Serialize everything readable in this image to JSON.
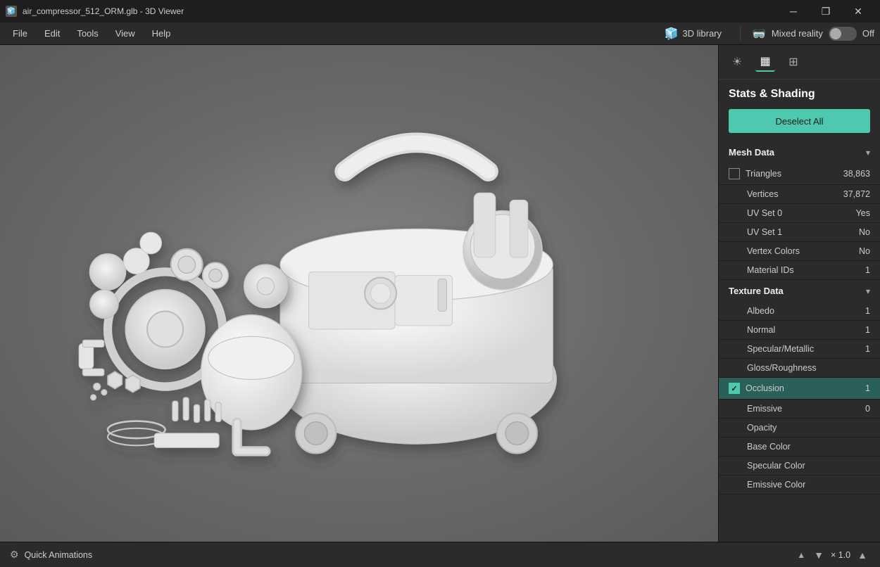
{
  "titleBar": {
    "title": "air_compressor_512_ORM.glb - 3D Viewer",
    "minBtn": "─",
    "maxBtn": "❐",
    "closeBtn": "✕"
  },
  "menuBar": {
    "items": [
      "File",
      "Edit",
      "Tools",
      "View",
      "Help"
    ],
    "library": "3D library",
    "mixedReality": "Mixed reality",
    "toggleState": "Off"
  },
  "panel": {
    "sectionTitle": "Stats & Shading",
    "deselectBtn": "Deselect All",
    "meshData": {
      "label": "Mesh Data",
      "rows": [
        {
          "label": "Triangles",
          "value": "38,863",
          "hasCheckbox": true,
          "checked": false
        },
        {
          "label": "Vertices",
          "value": "37,872"
        },
        {
          "label": "UV Set 0",
          "value": "Yes"
        },
        {
          "label": "UV Set 1",
          "value": "No"
        },
        {
          "label": "Vertex Colors",
          "value": "No"
        },
        {
          "label": "Material IDs",
          "value": "1"
        }
      ]
    },
    "textureData": {
      "label": "Texture Data",
      "rows": [
        {
          "label": "Albedo",
          "value": "1",
          "hasCheckbox": false,
          "checked": false
        },
        {
          "label": "Normal",
          "value": "1",
          "hasCheckbox": false,
          "checked": false
        },
        {
          "label": "Specular/Metallic",
          "value": "1",
          "hasCheckbox": false,
          "checked": false
        },
        {
          "label": "Gloss/Roughness",
          "value": "",
          "hasCheckbox": false,
          "checked": false
        },
        {
          "label": "Occlusion",
          "value": "1",
          "hasCheckbox": true,
          "checked": true,
          "selected": true
        },
        {
          "label": "Emissive",
          "value": "0",
          "hasCheckbox": false,
          "checked": false
        },
        {
          "label": "Opacity",
          "value": "",
          "hasCheckbox": false,
          "checked": false
        },
        {
          "label": "Base Color",
          "value": "",
          "hasCheckbox": false,
          "checked": false
        },
        {
          "label": "Specular Color",
          "value": "",
          "hasCheckbox": false,
          "checked": false
        },
        {
          "label": "Emissive Color",
          "value": "",
          "hasCheckbox": false,
          "checked": false
        }
      ]
    }
  },
  "bottomBar": {
    "label": "Quick Animations",
    "zoom": "× 1.0"
  }
}
